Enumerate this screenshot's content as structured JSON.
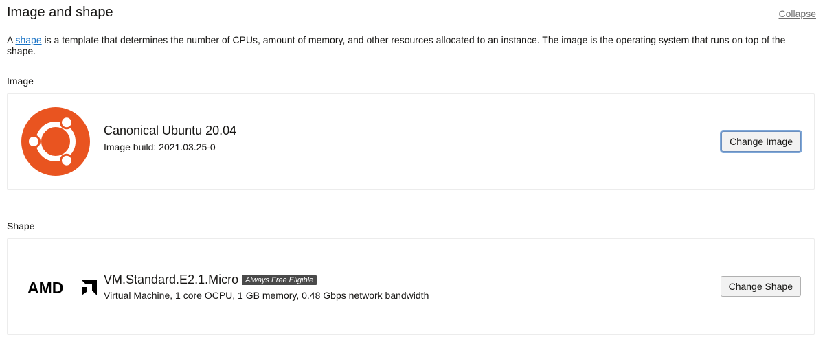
{
  "header": {
    "title": "Image and shape",
    "collapse_label": "Collapse"
  },
  "description": {
    "prefix": "A ",
    "link_text": "shape",
    "suffix": " is a template that determines the number of CPUs, amount of memory, and other resources allocated to an instance. The image is the operating system that runs on top of the shape."
  },
  "image_section": {
    "label": "Image",
    "name": "Canonical Ubuntu 20.04",
    "build": "Image build: 2021.03.25-0",
    "button_label": "Change Image",
    "logo_icon": "ubuntu-logo-icon",
    "logo_color": "#e95420"
  },
  "shape_section": {
    "label": "Shape",
    "name": "VM.Standard.E2.1.Micro",
    "badge": "Always Free Eligible",
    "details": "Virtual Machine, 1 core OCPU, 1 GB memory, 0.48 Gbps network bandwidth",
    "button_label": "Change Shape",
    "logo_icon": "amd-logo-icon",
    "logo_text": "AMD"
  }
}
